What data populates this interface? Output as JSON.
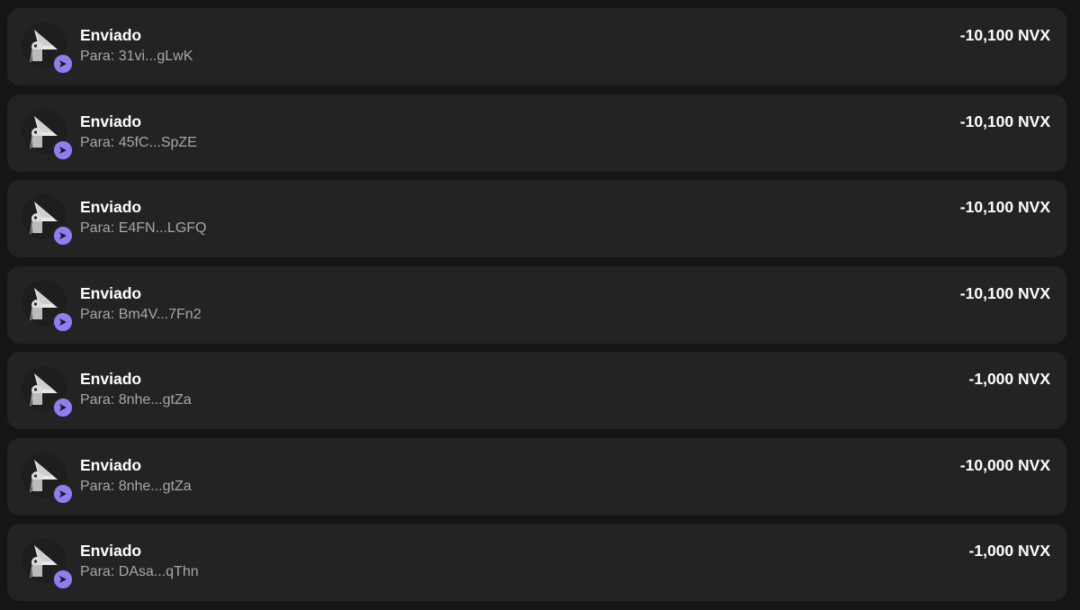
{
  "colors": {
    "background": "#151515",
    "row_background": "#232323",
    "badge_accent": "#8e7ef0",
    "primary_text": "#ffffff",
    "secondary_text": "#a7a7a7"
  },
  "transactions": [
    {
      "title": "Enviado",
      "recipient": "Para: 31vi...gLwK",
      "amount": "-10,100 NVX",
      "icon": "sent-arrow-icon"
    },
    {
      "title": "Enviado",
      "recipient": "Para: 45fC...SpZE",
      "amount": "-10,100 NVX",
      "icon": "sent-arrow-icon"
    },
    {
      "title": "Enviado",
      "recipient": "Para: E4FN...LGFQ",
      "amount": "-10,100 NVX",
      "icon": "sent-arrow-icon"
    },
    {
      "title": "Enviado",
      "recipient": "Para: Bm4V...7Fn2",
      "amount": "-10,100 NVX",
      "icon": "sent-arrow-icon"
    },
    {
      "title": "Enviado",
      "recipient": "Para: 8nhe...gtZa",
      "amount": "-1,000 NVX",
      "icon": "sent-arrow-icon"
    },
    {
      "title": "Enviado",
      "recipient": "Para: 8nhe...gtZa",
      "amount": "-10,000 NVX",
      "icon": "sent-arrow-icon"
    },
    {
      "title": "Enviado",
      "recipient": "Para: DAsa...qThn",
      "amount": "-1,000 NVX",
      "icon": "sent-arrow-icon"
    }
  ]
}
